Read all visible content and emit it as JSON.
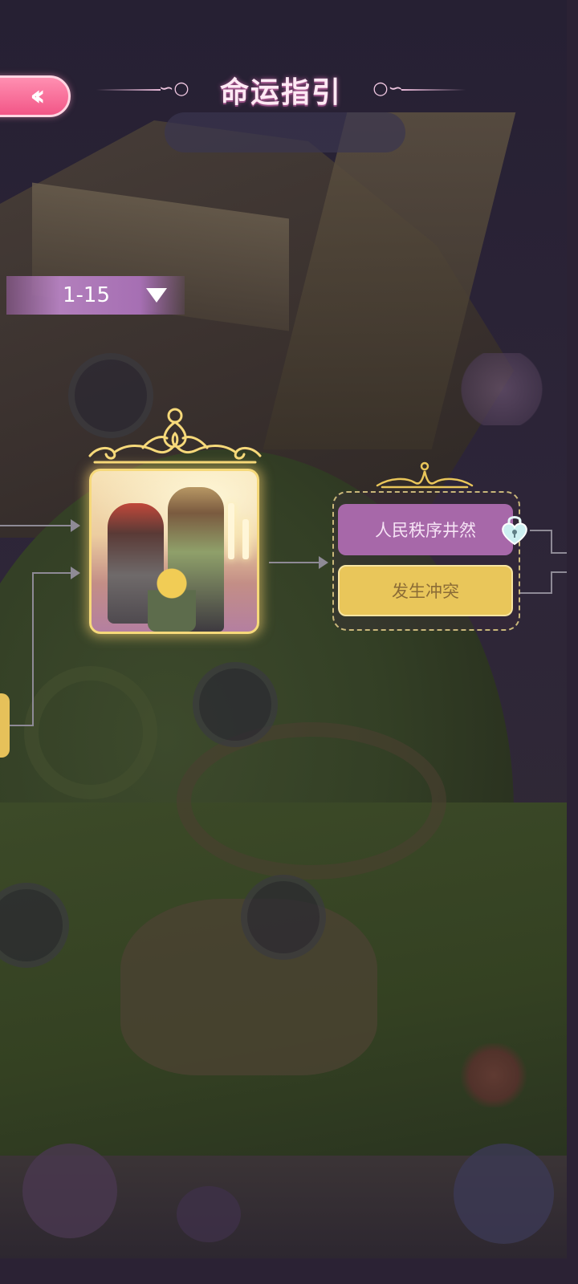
{
  "header": {
    "title": "命运指引",
    "back_icon": "double-chevron-left-icon",
    "back_glyph": "‹‹"
  },
  "chapter_selector": {
    "value": "1-15",
    "dropdown_icon": "triangle-down-icon"
  },
  "story_node": {
    "image": "illustration of villagers with a child, candles in background",
    "frame_icon": "crown-frame-icon"
  },
  "choices": [
    {
      "label": "人民秩序井然",
      "locked": true,
      "color": "#a768a9"
    },
    {
      "label": "发生冲突",
      "locked": false,
      "color": "#e9c65a"
    }
  ],
  "colors": {
    "accent_pink": "#f25687",
    "gold": "#f6d97a",
    "connector": "#8e8a96"
  }
}
